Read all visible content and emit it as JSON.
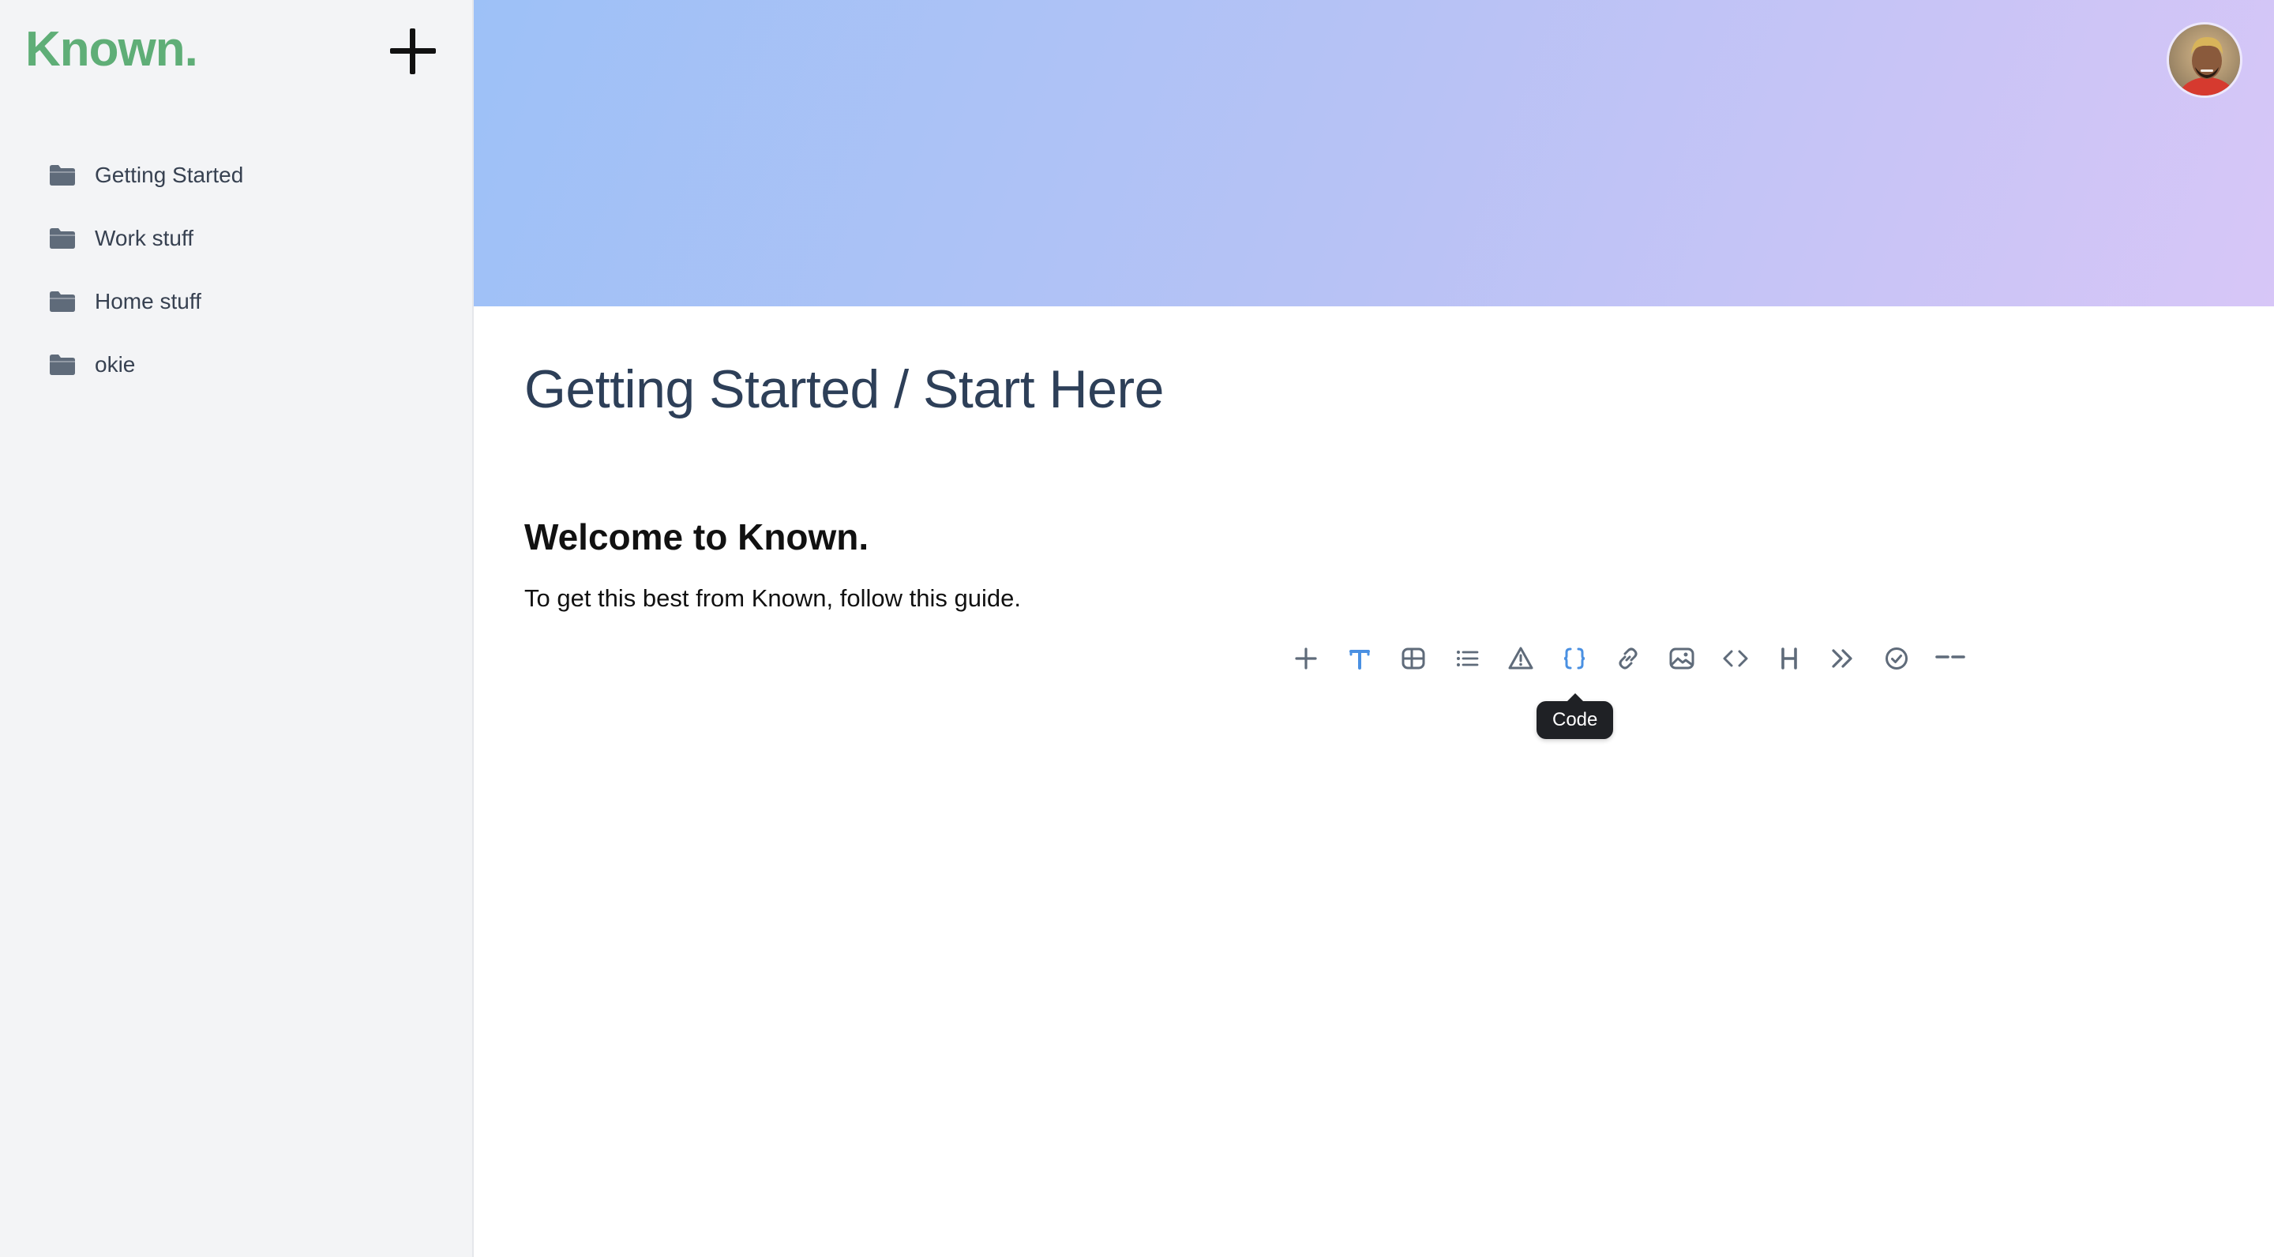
{
  "app": {
    "logo": "Known.",
    "brand_color": "#5fae77"
  },
  "sidebar": {
    "new_button_icon": "plus-icon",
    "items": [
      {
        "label": "Getting Started",
        "icon": "folder-icon"
      },
      {
        "label": "Work stuff",
        "icon": "folder-icon"
      },
      {
        "label": "Home stuff",
        "icon": "folder-icon"
      },
      {
        "label": "okie",
        "icon": "folder-icon"
      }
    ]
  },
  "header": {
    "banner_gradient": [
      "#9dc1f7",
      "#b7c2f5",
      "#d7c6f7"
    ],
    "avatar": "user-avatar"
  },
  "document": {
    "title": "Getting Started / Start Here",
    "heading": "Welcome to Known.",
    "paragraph": "To get this best from Known, follow this guide."
  },
  "toolbar": {
    "active_color": "#4a90e2",
    "tools": [
      {
        "name": "plus-icon",
        "active": false
      },
      {
        "name": "text-icon",
        "active": true
      },
      {
        "name": "table-icon",
        "active": false
      },
      {
        "name": "list-icon",
        "active": false
      },
      {
        "name": "warning-icon",
        "active": false
      },
      {
        "name": "code-block-icon",
        "active": true
      },
      {
        "name": "link-icon",
        "active": false
      },
      {
        "name": "image-icon",
        "active": false
      },
      {
        "name": "embed-code-icon",
        "active": false
      },
      {
        "name": "heading-icon",
        "active": false
      },
      {
        "name": "quote-icon",
        "active": false
      },
      {
        "name": "checklist-icon",
        "active": false
      },
      {
        "name": "divider-icon",
        "active": false
      }
    ],
    "tooltip": "Code"
  }
}
